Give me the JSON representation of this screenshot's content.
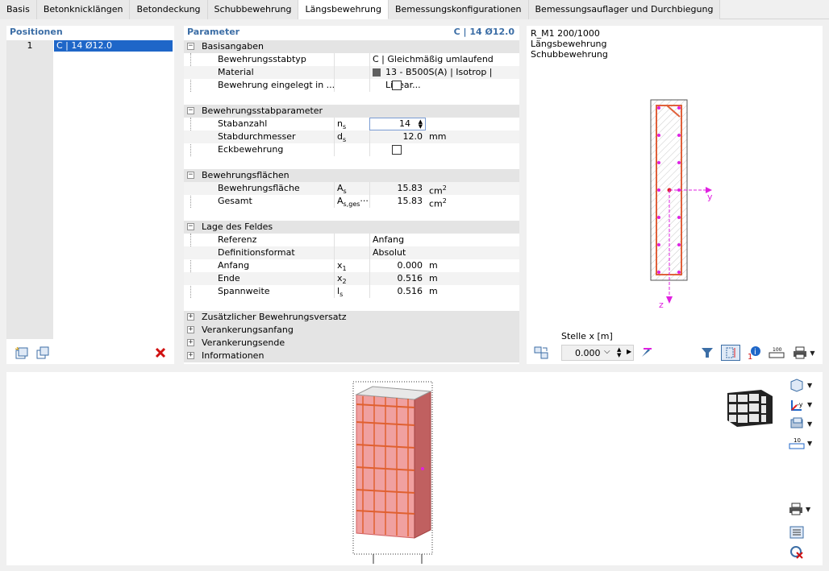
{
  "tabs": [
    "Basis",
    "Betonknicklängen",
    "Betondeckung",
    "Schubbewehrung",
    "Längsbewehrung",
    "Bemessungskonfigurationen",
    "Bemessungsauflager und Durchbiegung"
  ],
  "active_tab": "Längsbewehrung",
  "positions": {
    "title": "Positionen",
    "items": [
      {
        "num": "1",
        "name": "C | 14 Ø12.0"
      }
    ]
  },
  "parameter": {
    "title": "Parameter",
    "title_right": "C | 14 Ø12.0",
    "sections": {
      "basis": {
        "label": "Basisangaben",
        "rows": {
          "typ": {
            "label": "Bewehrungsstabtyp",
            "value": "C | Gleichmäßig umlaufend"
          },
          "material": {
            "label": "Material",
            "value": "13 - B500S(A) | Isotrop | Linear..."
          },
          "eingelegt": {
            "label": "Bewehrung eingelegt in ..."
          }
        }
      },
      "stab": {
        "label": "Bewehrungsstabparameter",
        "rows": {
          "anzahl": {
            "label": "Stabanzahl",
            "symbol": "ns",
            "value": "14"
          },
          "durchmesser": {
            "label": "Stabdurchmesser",
            "symbol": "ds",
            "value": "12.0",
            "unit": "mm"
          },
          "eck": {
            "label": "Eckbewehrung"
          }
        }
      },
      "flaechen": {
        "label": "Bewehrungsflächen",
        "rows": {
          "flaeche": {
            "label": "Bewehrungsfläche",
            "symbol": "As",
            "value": "15.83",
            "unit": "cm2"
          },
          "gesamt": {
            "label": "Gesamt",
            "symbol": "As,ges...",
            "value": "15.83",
            "unit": "cm2"
          }
        }
      },
      "lage": {
        "label": "Lage des Feldes",
        "rows": {
          "referenz": {
            "label": "Referenz",
            "value": "Anfang"
          },
          "format": {
            "label": "Definitionsformat",
            "value": "Absolut"
          },
          "anfang": {
            "label": "Anfang",
            "symbol": "x1",
            "value": "0.000",
            "unit": "m"
          },
          "ende": {
            "label": "Ende",
            "symbol": "x2",
            "value": "0.516",
            "unit": "m"
          },
          "spannweite": {
            "label": "Spannweite",
            "symbol": "ls",
            "value": "0.516",
            "unit": "m"
          }
        }
      },
      "versatz": {
        "label": "Zusätzlicher Bewehrungsversatz"
      },
      "verank_anfang": {
        "label": "Verankerungsanfang"
      },
      "verank_ende": {
        "label": "Verankerungsende"
      },
      "info": {
        "label": "Informationen"
      }
    }
  },
  "view2d": {
    "line1": "R_M1 200/1000",
    "line2": "Längsbewehrung",
    "line3": "Schubbewehrung",
    "axis_y": "y",
    "axis_z": "z",
    "stelle_label": "Stelle x [m]",
    "stelle_value": "0.000",
    "scale_label": "100"
  },
  "view3d": {
    "scale_label": "10"
  },
  "colors": {
    "accent": "#3c6ea6",
    "rebar": "#e0603a",
    "axis": "#e020e0",
    "selection": "#1e66c8"
  }
}
